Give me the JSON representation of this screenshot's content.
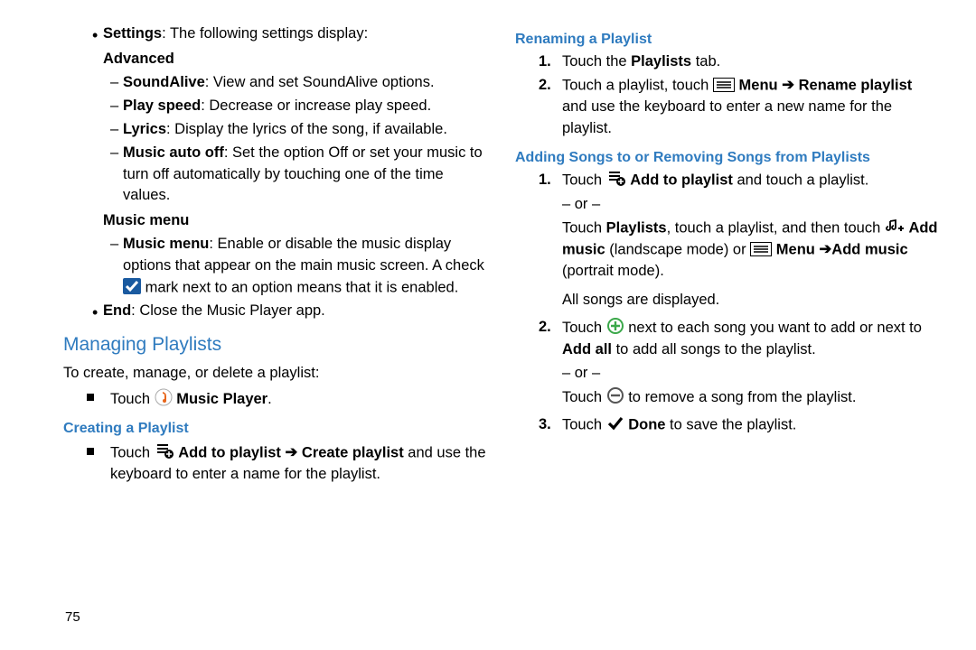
{
  "left": {
    "settings_intro_bold": "Settings",
    "settings_intro_rest": ": The following settings display:",
    "advanced": "Advanced",
    "soundalive_b": "SoundAlive",
    "soundalive_rest": ": View and set SoundAlive options.",
    "playspeed_b": "Play speed",
    "playspeed_rest": ": Decrease or increase play speed.",
    "lyrics_b": "Lyrics",
    "lyrics_rest": ": Display the lyrics of the song, if available.",
    "autooff_b": "Music auto off",
    "autooff_rest": ": Set the option Off or set your music to turn off automatically by touching one of the time values.",
    "musicmenu_h": "Music menu",
    "musicmenu_b": "Music menu",
    "musicmenu_rest1": ": Enable or disable the music display options that appear on the main music screen. A check ",
    "musicmenu_rest2": "mark next to an option means that it is enabled.",
    "end_b": "End",
    "end_rest": ": Close the Music Player app.",
    "h_managing": "Managing Playlists",
    "create_intro": "To create, manage, or delete a playlist:",
    "touch": "Touch ",
    "music_player": " Music Player",
    "h_creating": "Creating a Playlist",
    "add_to_playlist": " Add to playlist ",
    "create_playlist": " Create playlist",
    "create_rest": " and use the keyboard to enter a name for the playlist."
  },
  "right": {
    "h_renaming": "Renaming a Playlist",
    "r1a": "Touch the ",
    "r1b": "Playlists",
    "r1c": " tab.",
    "r2a": "Touch a playlist, touch ",
    "menu": " Menu ",
    "rename_playlist": " Rename playlist",
    "r2c": " and use the keyboard to enter a new name for the playlist.",
    "h_adding": "Adding Songs to or Removing Songs from Playlists",
    "a1a": "Touch ",
    "add_to_playlist": " Add to playlist",
    "a1c": " and touch a playlist.",
    "or": "– or –",
    "a1d": "Touch ",
    "playlists": "Playlists",
    "a1e": ", touch a playlist, and then touch ",
    "add_music": " Add music",
    "landscape": " (landscape mode) or ",
    "menu2": " Menu ",
    "add_music2": "Add music",
    "portrait": " (portrait mode).",
    "all_songs": "All songs are displayed.",
    "a2a": "Touch ",
    "a2b": " next to each song you want to add or next to ",
    "add_all": "Add all",
    "a2c": " to add all songs to the playlist.",
    "a2d": " to remove a song from the playlist.",
    "a3a": "Touch ",
    "done": " Done",
    "a3b": " to save the playlist."
  },
  "page_number": "75"
}
